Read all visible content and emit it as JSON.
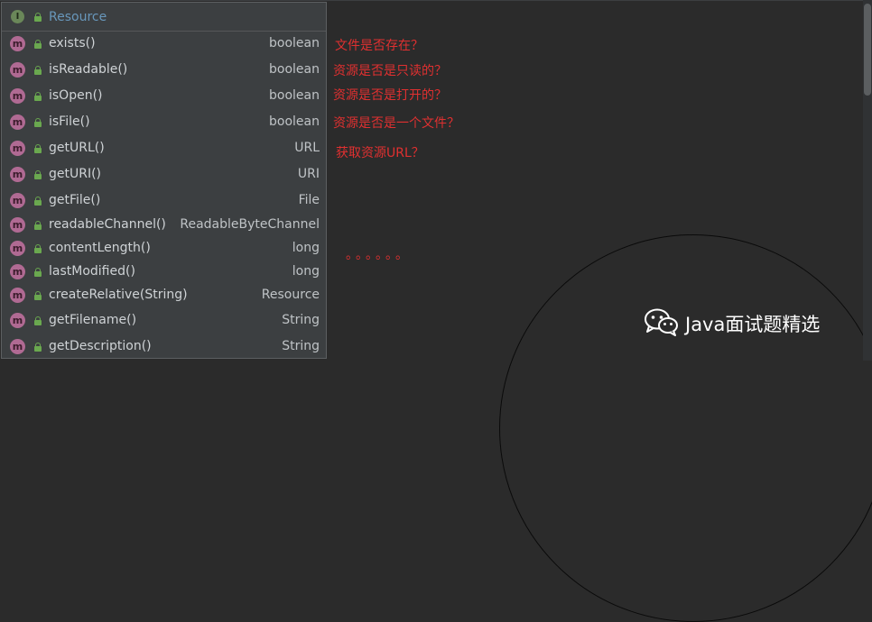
{
  "popup": {
    "header": {
      "badge": "I",
      "title": "Resource"
    },
    "method_badge": "m",
    "members": [
      {
        "name": "exists()",
        "type": "boolean"
      },
      {
        "name": "isReadable()",
        "type": "boolean"
      },
      {
        "name": "isOpen()",
        "type": "boolean"
      },
      {
        "name": "isFile()",
        "type": "boolean"
      },
      {
        "name": "getURL()",
        "type": "URL"
      },
      {
        "name": "getURI()",
        "type": "URI"
      },
      {
        "name": "getFile()",
        "type": "File"
      },
      {
        "name": "readableChannel()",
        "type": "ReadableByteChannel"
      },
      {
        "name": "contentLength()",
        "type": "long"
      },
      {
        "name": "lastModified()",
        "type": "long"
      },
      {
        "name": "createRelative(String)",
        "type": "Resource"
      },
      {
        "name": "getFilename()",
        "type": "String"
      },
      {
        "name": "getDescription()",
        "type": "String"
      }
    ]
  },
  "annotations": [
    "文件是否存在？",
    "资源是否是只读的？",
    "资源是否是打开的？",
    "资源是否是一个文件？",
    "获取资源URL？"
  ],
  "ellipsis": "。。。。。。",
  "watermark": {
    "text": "Java面试题精选",
    "logo": "wechat-icon"
  },
  "colors": {
    "background": "#2b2b2b",
    "popup": "#3c3f41",
    "annotation": "#e03030",
    "interface_badge": "#6a8759",
    "method_badge": "#b06a93",
    "title": "#6897bb"
  }
}
